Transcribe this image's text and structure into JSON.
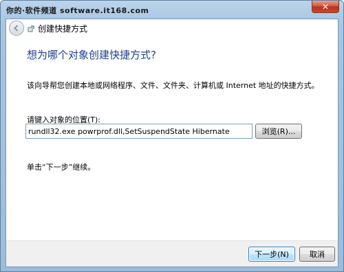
{
  "watermark": {
    "text": "你的·软件频道 software.it168.com"
  },
  "window": {
    "close_glyph": "✕"
  },
  "nav": {
    "title": "创建快捷方式",
    "back_icon": "back-arrow-icon",
    "wizard_icon": "wizard-icon"
  },
  "page": {
    "heading": "想为哪个对象创建快捷方式?",
    "description": "该向导帮您创建本地或网络程序、文件、文件夹、计算机或 Internet 地址的快捷方式。",
    "field_label": "请键入对象的位置(T):",
    "field_value": "rundll32.exe powrprof.dll,SetSuspendState Hibernate",
    "browse_label": "浏览(R)...",
    "hint": "单击“下一步”继续。"
  },
  "footer": {
    "next_label": "下一步(N)",
    "cancel_label": "取消"
  },
  "colors": {
    "heading": "#1e3f8c",
    "frame": "#a8c6e2",
    "close_button": "#c6492c",
    "default_button_border": "#3c7fb1"
  }
}
